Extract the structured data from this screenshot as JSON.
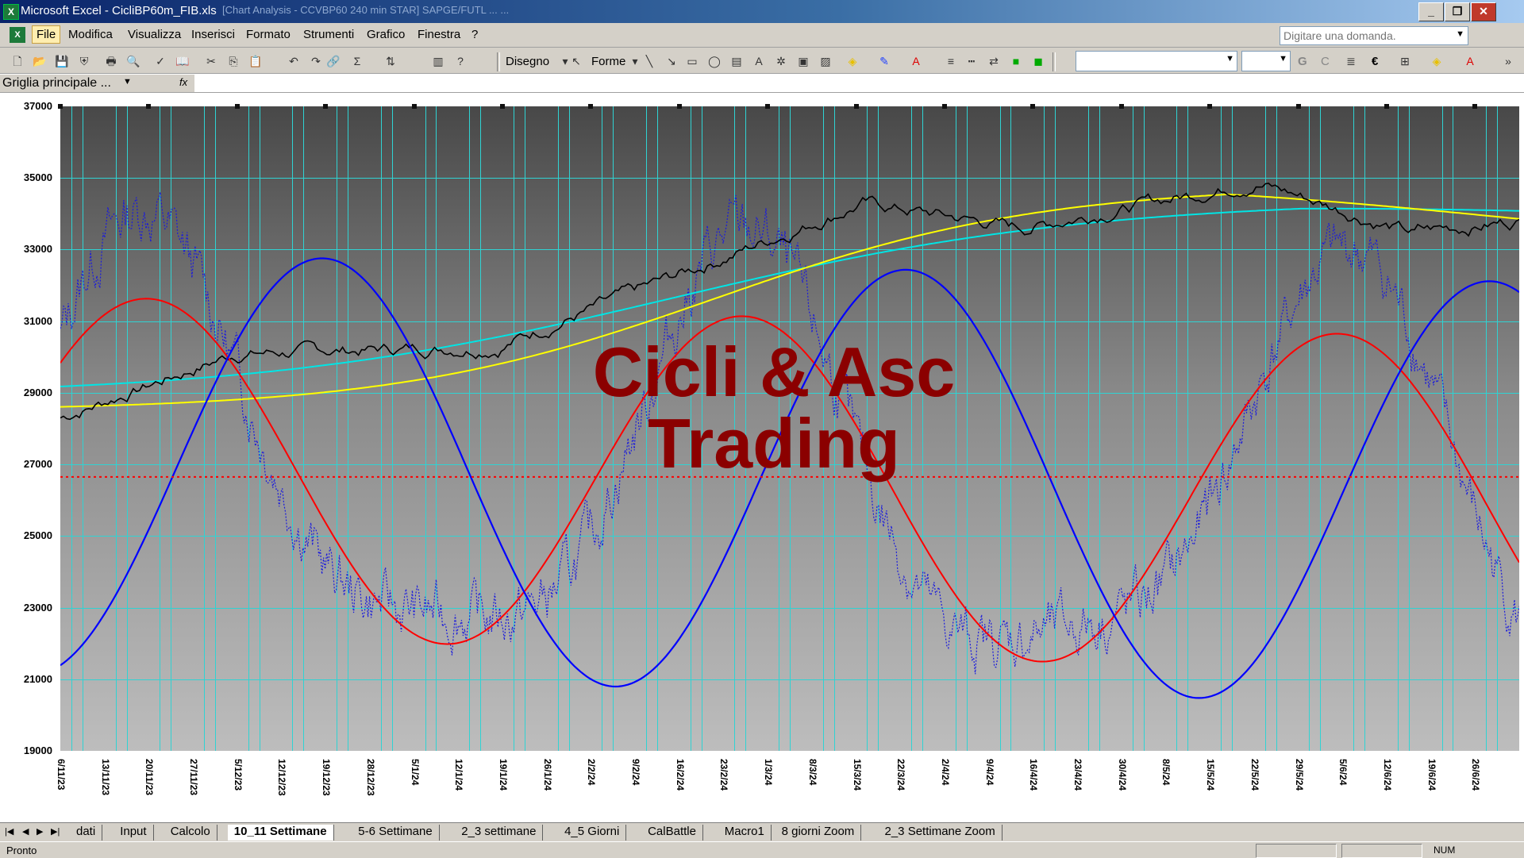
{
  "window": {
    "title": "Microsoft Excel - CicliBP60m_FIB.xls",
    "ghost_title": "[Chart Analysis - CCVBP60 240 min STAR] SAPGE/FUTL  ...  ..."
  },
  "menu": {
    "items": [
      "File",
      "Modifica",
      "Visualizza",
      "Inserisci",
      "Formato",
      "Strumenti",
      "Grafico",
      "Finestra",
      "?"
    ]
  },
  "search": {
    "placeholder": "Digitare una domanda."
  },
  "toolbar": {
    "disegno_label": "Disegno",
    "forme_label": "Forme",
    "bold_label": "G",
    "italic_label": "C",
    "euro_label": "€"
  },
  "namebox": {
    "value": "Griglia principale ...",
    "fx": "fx"
  },
  "chart": {
    "y_ticks": [
      "37000",
      "35000",
      "33000",
      "31000",
      "29000",
      "27000",
      "25000",
      "23000",
      "21000",
      "19000"
    ],
    "x_ticks": [
      "6/11/23",
      "13/11/23",
      "20/11/23",
      "27/11/23",
      "5/12/23",
      "12/12/23",
      "19/12/23",
      "28/12/23",
      "5/1/24",
      "12/1/24",
      "19/1/24",
      "26/1/24",
      "2/2/24",
      "9/2/24",
      "16/2/24",
      "23/2/24",
      "1/3/24",
      "8/3/24",
      "15/3/24",
      "22/3/24",
      "2/4/24",
      "9/4/24",
      "16/4/24",
      "23/4/24",
      "30/4/24",
      "8/5/24",
      "15/5/24",
      "22/5/24",
      "29/5/24",
      "5/6/24",
      "12/6/24",
      "19/6/24",
      "26/6/24"
    ],
    "watermark_line1": "Cicli & Asc",
    "watermark_line2": "Trading",
    "colors": {
      "price": "#000000",
      "yellow_ma": "#FFFF00",
      "cyan_ma": "#00E5E5",
      "red_cycle": "#FF0000",
      "blue_cycle": "#0000FF",
      "dotted_osc": "#1A1ADD",
      "grid": "#2FD3D3",
      "watermark": "#8B0000"
    }
  },
  "sheets": {
    "tabs": [
      "dati",
      "Input",
      "Calcolo",
      "10_11 Settimane",
      "5-6 Settimane",
      "2_3 settimane",
      "4_5 Giorni",
      "CalBattle",
      "Macro1",
      "8 giorni Zoom",
      "2_3 Settimane Zoom"
    ],
    "active": "10_11 Settimane"
  },
  "status": {
    "text": "Pronto",
    "num": "NUM"
  }
}
